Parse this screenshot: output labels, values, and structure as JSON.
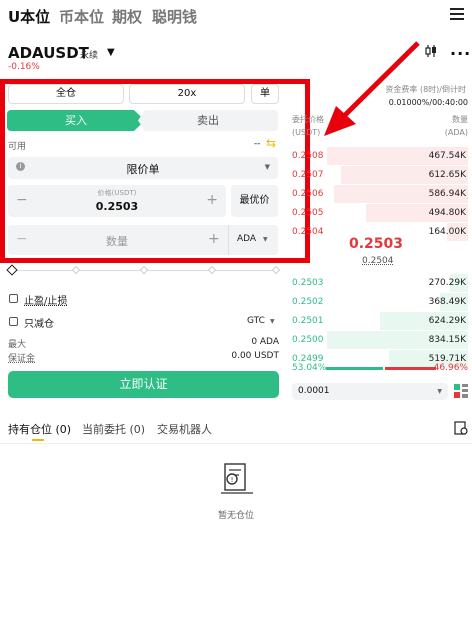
{
  "top_nav": {
    "tabs": [
      "U本位",
      "币本位",
      "期权",
      "聪明钱"
    ]
  },
  "instrument": {
    "symbol": "ADAUSDT",
    "badge": "永续",
    "change": "-0.16%"
  },
  "order_form": {
    "margin_mode": "全仓",
    "leverage": "20x",
    "position_mode": "单",
    "buy_tab": "买入",
    "sell_tab": "卖出",
    "available_label": "可用",
    "available_value": "--",
    "order_type": "限价单",
    "price_label": "价格(USDT)",
    "price_value": "0.2503",
    "best_price": "最优价",
    "qty_placeholder": "数量",
    "qty_unit": "ADA",
    "tp_sl": "止盈/止损",
    "reduce_only": "只减仓",
    "tif": "GTC",
    "max_label": "最大",
    "max_value": "0 ADA",
    "margin_label": "保证金",
    "margin_value": "0.00 USDT",
    "submit": "立即认证"
  },
  "orderbook": {
    "funding_label": "资金费率 (8时)/倒计时",
    "funding_value": "0.01000%/00:40:00",
    "price_header": [
      "委托价格",
      "(USDT)"
    ],
    "qty_header": [
      "数量",
      "(ADA)"
    ],
    "asks": [
      {
        "price": "0.2508",
        "qty": "467.54K",
        "depth": 0.8
      },
      {
        "price": "0.2507",
        "qty": "612.65K",
        "depth": 0.72
      },
      {
        "price": "0.2506",
        "qty": "586.94K",
        "depth": 0.76
      },
      {
        "price": "0.2505",
        "qty": "494.80K",
        "depth": 0.58
      },
      {
        "price": "0.2504",
        "qty": "164.00K",
        "depth": 0.12
      }
    ],
    "last_price": "0.2503",
    "mark_price": "0.2504",
    "bids": [
      {
        "price": "0.2503",
        "qty": "270.29K",
        "depth": 0.1
      },
      {
        "price": "0.2502",
        "qty": "368.49K",
        "depth": 0.16
      },
      {
        "price": "0.2501",
        "qty": "624.29K",
        "depth": 0.5
      },
      {
        "price": "0.2500",
        "qty": "834.15K",
        "depth": 0.8
      },
      {
        "price": "0.2499",
        "qty": "519.71K",
        "depth": 0.45
      }
    ],
    "buy_ratio": "53.04%",
    "sell_ratio": "46.96%",
    "tick": "0.0001"
  },
  "bottom_tabs": [
    "持有仓位 (0)",
    "当前委托 (0)",
    "交易机器人"
  ],
  "empty_text": "暂无仓位",
  "colors": {
    "green": "#2ebd85",
    "red": "#e5383b",
    "annotation": "#e8000b"
  }
}
